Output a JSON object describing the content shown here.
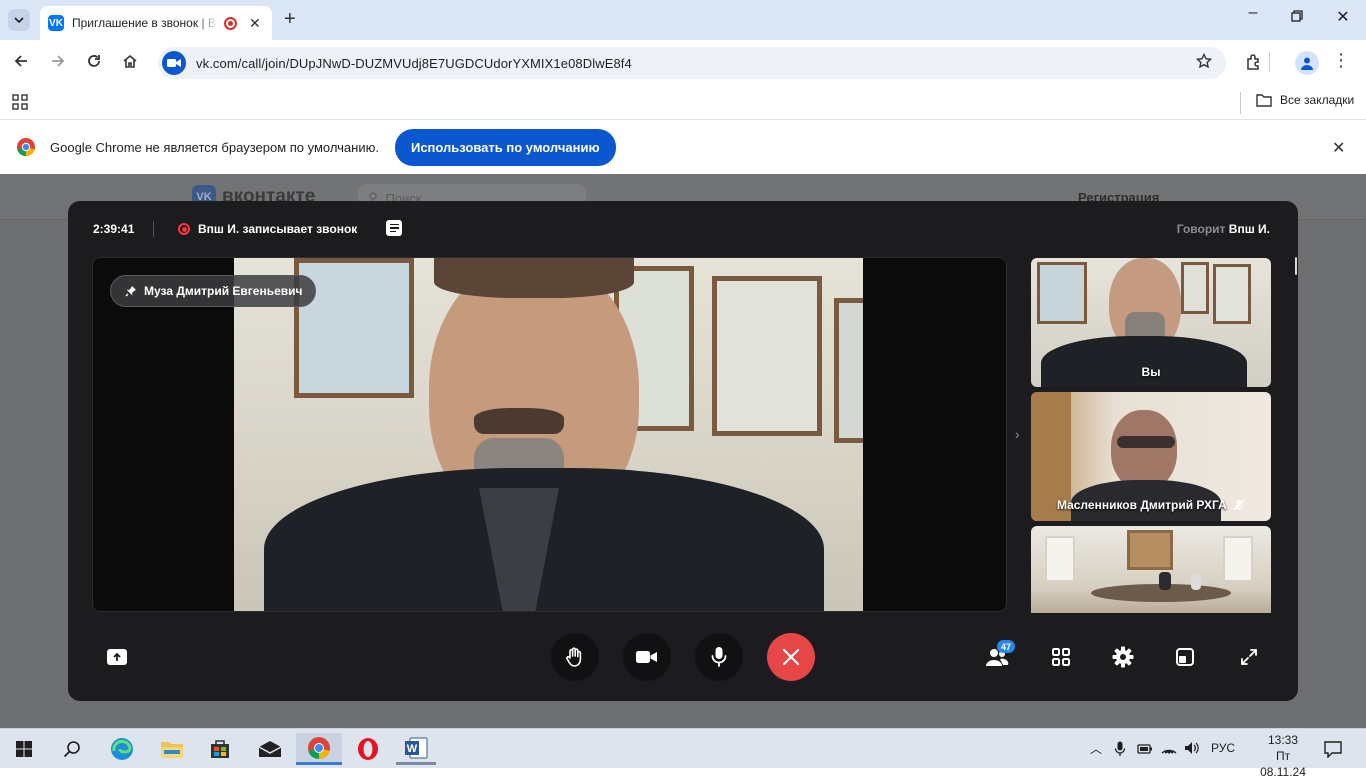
{
  "browser": {
    "tab_title": "Приглашение в звонок | ВКонтакте",
    "url": "vk.com/call/join/DUpJNwD-DUZMVUdj8E7UGDCUdorYXMIX1e08DlwE8f4",
    "bookmarks_label": "Все закладки"
  },
  "infobar": {
    "message": "Google Chrome не является браузером по умолчанию.",
    "button": "Использовать по умолчанию"
  },
  "vk_page": {
    "logo_text": "вконтакте",
    "search_placeholder": "Поиск",
    "register": "Регистрация"
  },
  "call": {
    "timer": "2:39:41",
    "recording_text": "Впш И. записывает звонок",
    "speaking_prefix": "Говорит",
    "speaking_name": "Впш И.",
    "pinned_name": "Муза Дмитрий Евгеньевич",
    "participants": [
      {
        "name": "Вы"
      },
      {
        "name": "Масленников Дмитрий РХГА"
      },
      {
        "name": ""
      }
    ],
    "participants_count": "47"
  },
  "taskbar": {
    "lang": "РУС",
    "time": "13:33",
    "date": "Пт 08.11.24"
  },
  "colors": {
    "chrome_blue": "#0b57d0",
    "vk_blue": "#0077ff",
    "end_call_red": "#e64646",
    "rec_red": "#ff3347",
    "modal_bg": "#1c1c1e"
  }
}
